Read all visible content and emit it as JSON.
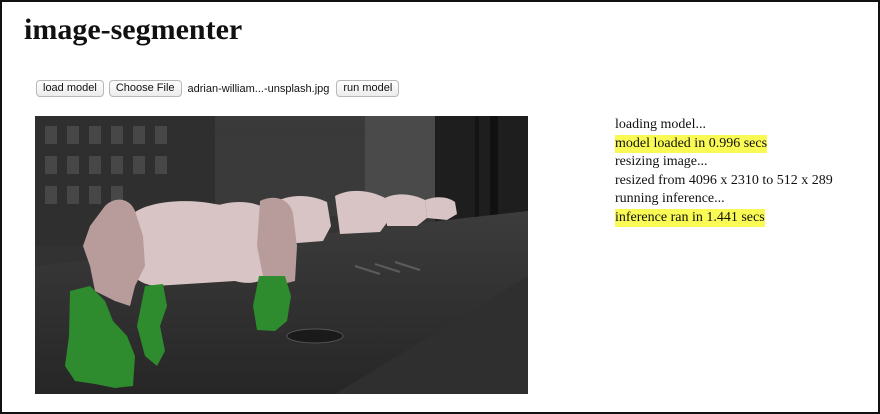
{
  "page": {
    "title": "image-segmenter"
  },
  "controls": {
    "load_model_label": "load model",
    "choose_file_label": "Choose File",
    "file_name": "adrian-william...-unsplash.jpg",
    "run_model_label": "run model"
  },
  "log": [
    {
      "text": "loading model...",
      "highlight": false
    },
    {
      "text": "model loaded in 0.996 secs",
      "highlight": true
    },
    {
      "text": "resizing image...",
      "highlight": false
    },
    {
      "text": "resized from 4096 x 2310 to 512 x 289",
      "highlight": false
    },
    {
      "text": "running inference...",
      "highlight": false
    },
    {
      "text": "inference ran in 1.441 secs",
      "highlight": true
    }
  ],
  "colors": {
    "highlight": "#fafa55",
    "car_mask": "#d8c4c4",
    "person_mask_upper": "#b89c9c",
    "person_mask_lower": "#2e8b2e"
  }
}
